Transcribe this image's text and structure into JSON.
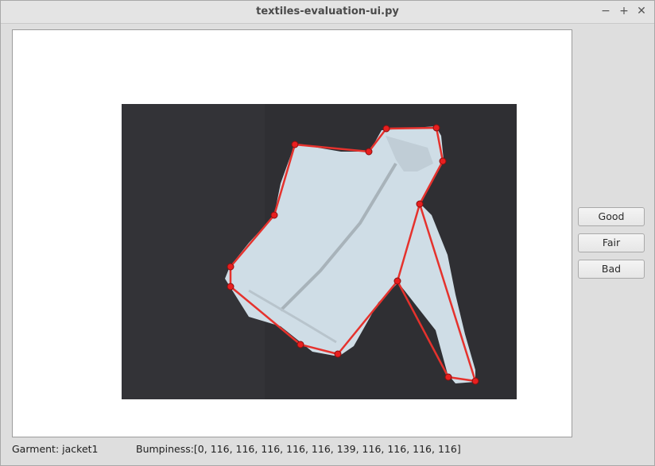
{
  "window": {
    "title": "textiles-evaluation-ui.py",
    "controls": {
      "minimize": "−",
      "maximize": "+",
      "close": "✕"
    }
  },
  "rating_buttons": [
    "Good",
    "Fair",
    "Bad"
  ],
  "status": {
    "garment": "Garment: jacket1",
    "bumpiness": "Bumpiness:[0, 116, 116, 116, 116, 116, 139, 116, 116, 116, 116]"
  },
  "colors": {
    "outline": "#e5322d",
    "vertex": "#e81f1f",
    "garment": "#cfdde6",
    "background": "#2f2f33"
  },
  "icons": {
    "minimize": "minimize-icon",
    "maximize": "maximize-icon",
    "close": "close-icon"
  }
}
